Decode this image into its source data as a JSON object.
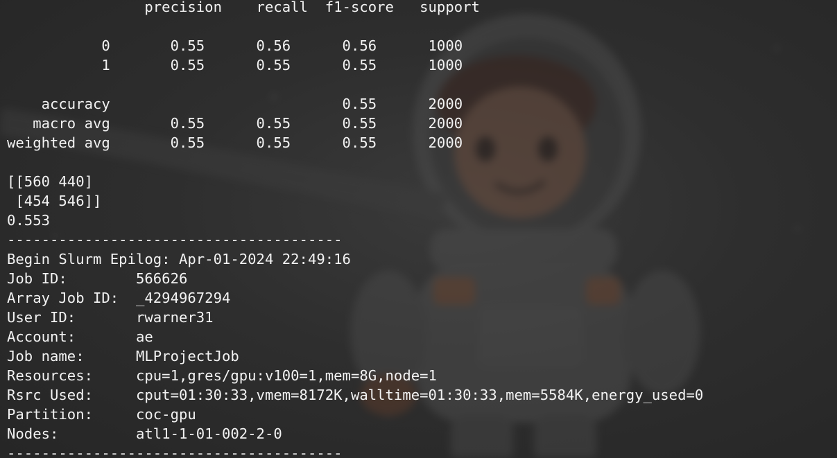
{
  "terminal": {
    "lines": [
      "                precision    recall  f1-score   support",
      "",
      "           0       0.55      0.56      0.56      1000",
      "           1       0.55      0.55      0.55      1000",
      "",
      "    accuracy                           0.55      2000",
      "   macro avg       0.55      0.55      0.55      2000",
      "weighted avg       0.55      0.55      0.55      2000",
      "",
      "[[560 440]",
      " [454 546]]",
      "0.553",
      "---------------------------------------",
      "Begin Slurm Epilog: Apr-01-2024 22:49:16",
      "Job ID:        566626",
      "Array Job ID:  _4294967294",
      "User ID:       rwarner31",
      "Account:       ae",
      "Job name:      MLProjectJob",
      "Resources:     cpu=1,gres/gpu:v100=1,mem=8G,node=1",
      "Rsrc Used:     cput=01:30:33,vmem=8172K,walltime=01:30:33,mem=5584K,energy_used=0",
      "Partition:     coc-gpu",
      "Nodes:         atl1-1-01-002-2-0",
      "---------------------------------------"
    ]
  },
  "background": {
    "image": "astronaut-illustration",
    "base_color": "#2a2a2a",
    "text_color": "#f2f2f2"
  }
}
